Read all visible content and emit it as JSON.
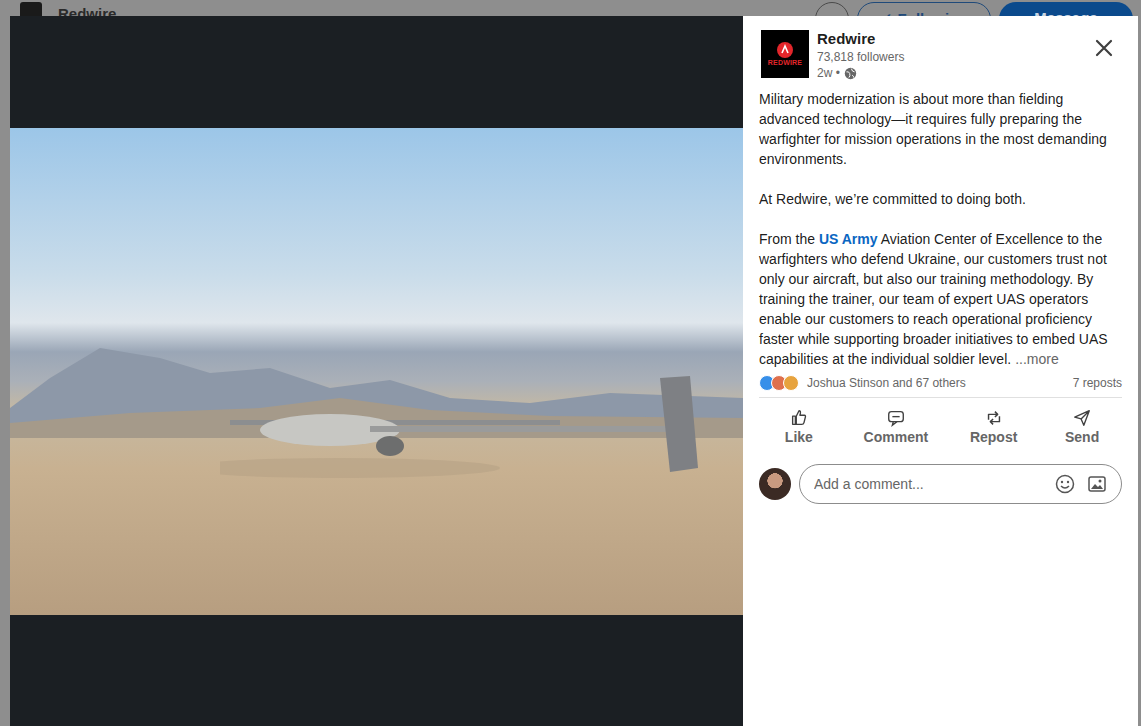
{
  "page_header": {
    "name": "Redwire",
    "buttons": [
      {
        "icon": "···",
        "label": ""
      },
      {
        "icon": "✓",
        "label": "Following"
      },
      {
        "icon": "",
        "label": "Message"
      }
    ]
  },
  "post": {
    "author": {
      "name": "Redwire",
      "logo_text": "REDWIRE",
      "followers": "73,818 followers",
      "time": "2w •"
    },
    "paragraphs": [
      [
        {
          "kind": "text",
          "text": "Military modernization is about more than fielding advanced technology—it requires fully preparing the warfighter for mission operations in the most demanding environments."
        }
      ],
      [
        {
          "kind": "text",
          "text": "At Redwire, we’re committed to doing both."
        }
      ],
      [
        {
          "kind": "text",
          "text": "From the "
        },
        {
          "kind": "link",
          "text": "US Army"
        },
        {
          "kind": "text",
          "text": " Aviation Center of Excellence to the warfighters who defend Ukraine, our customers trust not only our aircraft, but also our training methodology. By training the trainer, our team of expert UAS operators enable our customers to reach operational proficiency faster while supporting broader initiatives to embed UAS capabilities at the individual soldier level."
        },
        {
          "kind": "more",
          "text": "...more"
        }
      ]
    ],
    "reactions": {
      "icons": [
        {
          "color": "#378fe9"
        },
        {
          "color": "#df704d"
        },
        {
          "color": "#e7a33e"
        }
      ],
      "summary": "Joshua Stinson and 67 others",
      "reposts": "7 reposts"
    },
    "actions": [
      {
        "label": "Like",
        "kind": "like"
      },
      {
        "label": "Comment",
        "kind": "comment"
      },
      {
        "label": "Repost",
        "kind": "repost"
      },
      {
        "label": "Send",
        "kind": "send"
      }
    ],
    "comment": {
      "placeholder": "Add a comment..."
    }
  }
}
